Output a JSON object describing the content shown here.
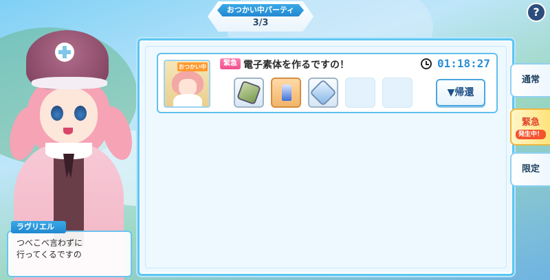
{
  "header": {
    "title": "おつかい中パーティ",
    "count": "3/3"
  },
  "help": {
    "label": "?"
  },
  "quest": {
    "thumb_tag": "おつかい中",
    "badge": "緊急",
    "title": "電子素体を作るですの！",
    "timer": "01:18:27",
    "items": [
      {
        "icon": "mineral-icon",
        "filled": true,
        "style": "normal"
      },
      {
        "icon": "bottle-icon",
        "filled": true,
        "style": "orange"
      },
      {
        "icon": "crystal-icon",
        "filled": true,
        "style": "normal"
      },
      {
        "icon": null,
        "filled": false
      },
      {
        "icon": null,
        "filled": false
      }
    ],
    "return_label": "▼帰還"
  },
  "tabs": {
    "normal": "通常",
    "urgent": "緊急",
    "urgent_sub": "発生中！",
    "limited": "限定"
  },
  "dialog": {
    "speaker": "ラヴリエル",
    "line1": "つべこべ言わずに",
    "line2": "行ってくるですの"
  },
  "colors": {
    "accent": "#2388d1",
    "urgent": "#f0508a",
    "timer": "#2a8fd6",
    "panel_border": "#5cc6f2"
  }
}
